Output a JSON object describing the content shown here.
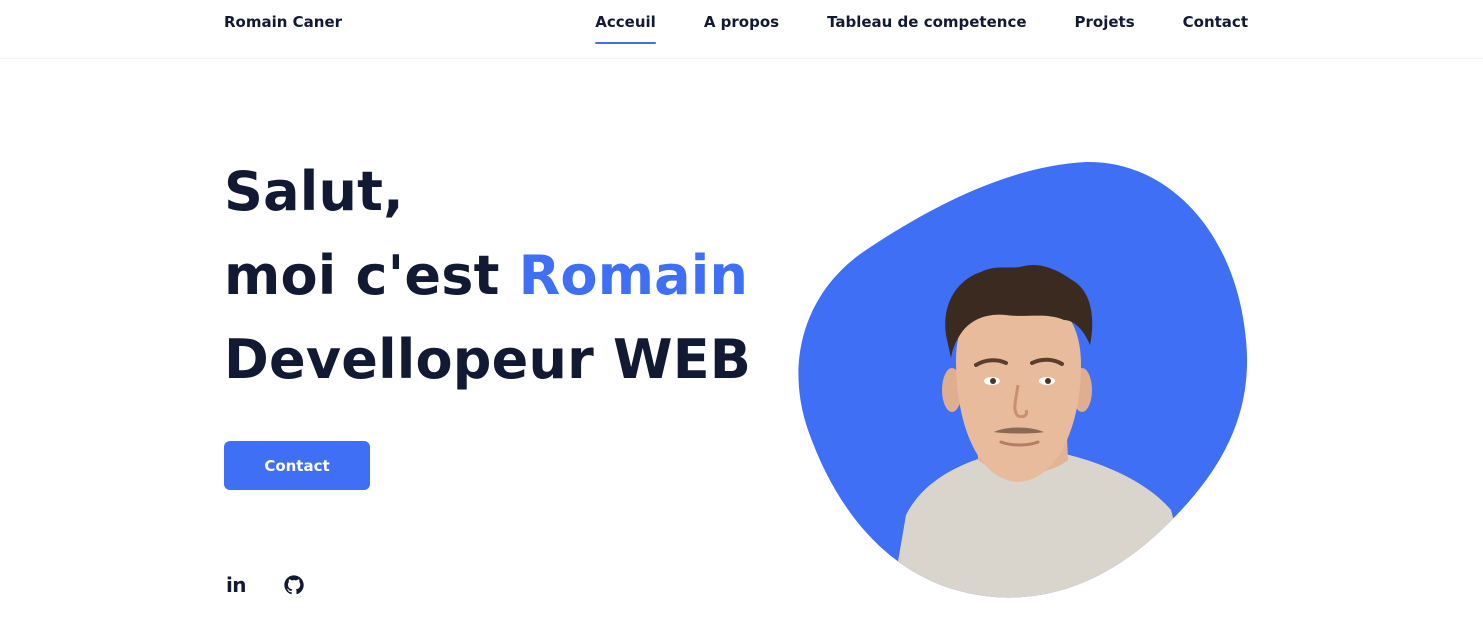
{
  "header": {
    "brand": "Romain Caner",
    "nav": [
      {
        "label": "Acceuil",
        "active": true
      },
      {
        "label": "A propos",
        "active": false
      },
      {
        "label": "Tableau de competence",
        "active": false
      },
      {
        "label": "Projets",
        "active": false
      },
      {
        "label": "Contact",
        "active": false
      }
    ]
  },
  "hero": {
    "line1": "Salut,",
    "line2_prefix": "moi c'est ",
    "line2_name": "Romain",
    "line3": "Devellopeur WEB",
    "cta_label": "Contact",
    "socials": [
      {
        "icon": "linkedin-icon",
        "text": "in"
      },
      {
        "icon": "github-icon"
      }
    ]
  },
  "colors": {
    "accent": "#3e6ff4",
    "text": "#121a33",
    "background": "#ffffff"
  }
}
